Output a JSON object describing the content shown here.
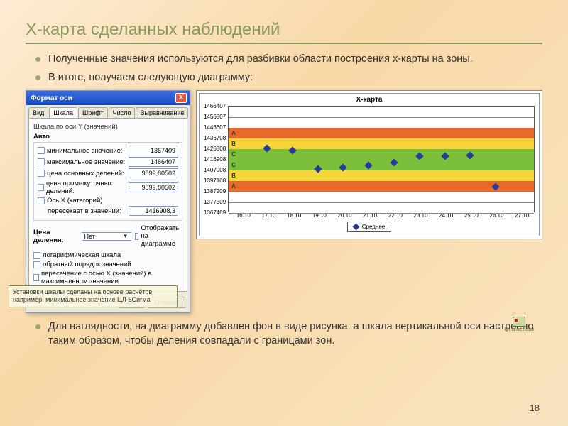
{
  "slide": {
    "title": "X-карта сделанных наблюдений",
    "bullets_top": [
      "Полученные значения используются для разбивки области построения x-карты на зоны.",
      "В итоге, получаем следующую диаграмму:"
    ],
    "bullet_bottom": "Для наглядности, на диаграмму добавлен фон в виде рисунка: а шкала вертикальной оси настроено таким образом, чтобы деления совпадали с границами зон.",
    "note": "Установки шкалы сделаны на основе расчётов, например, минимальное значение ЦЛ-5Сигма",
    "page": "18",
    "pic_caption": "От анкеВави"
  },
  "dialog": {
    "title": "Формат оси",
    "close": "X",
    "tabs": [
      "Вид",
      "Шкала",
      "Шрифт",
      "Число",
      "Выравнивание"
    ],
    "active_tab": 1,
    "section1_title": "Шкала по оси Y (значений)",
    "auto_label": "Авто",
    "fields": [
      {
        "label": "минимальное значение:",
        "value": "1367409"
      },
      {
        "label": "максимальное значение:",
        "value": "1466407"
      },
      {
        "label": "цена основных делений:",
        "value": "9899,80502"
      },
      {
        "label": "цена промежуточных делений:",
        "value": "9899,80502"
      }
    ],
    "axis_x": {
      "label": "Ось X (категорий)",
      "sublabel": "пересекает в значении:",
      "value": "1416908,3"
    },
    "unit_label": "Цена деления:",
    "unit_value": "Нет",
    "display_cb": "Отображать на диаграмме",
    "checks": [
      "логарифмическая шкала",
      "обратный порядок значений",
      "пересечение с осью X (значений) в максимальном значении"
    ],
    "ok": "ОК",
    "cancel": "Отмена"
  },
  "chart_data": {
    "type": "scatter",
    "title": "X-карта",
    "ylim": [
      1367409,
      1466407
    ],
    "y_ticks": [
      1466407,
      1456507,
      1446607,
      1436708,
      1426808,
      1416908,
      1407008,
      1397108,
      1387209,
      1377309,
      1367409
    ],
    "x_categories": [
      "16.10",
      "17.10",
      "18.10",
      "19.10",
      "20.10",
      "21.10",
      "22.10",
      "23.10",
      "24.10",
      "25.10",
      "26.10",
      "27.10"
    ],
    "bands": [
      {
        "label": "A",
        "from": 1446607,
        "to": 1436708,
        "color": "#e86a2a"
      },
      {
        "label": "B",
        "from": 1436708,
        "to": 1426808,
        "color": "#f5d63a"
      },
      {
        "label": "C",
        "from": 1426808,
        "to": 1416908,
        "color": "#7bbf3a"
      },
      {
        "label": "C",
        "from": 1416908,
        "to": 1407008,
        "color": "#7bbf3a"
      },
      {
        "label": "B",
        "from": 1407008,
        "to": 1397108,
        "color": "#f5d63a"
      },
      {
        "label": "A",
        "from": 1397108,
        "to": 1387209,
        "color": "#e86a2a"
      }
    ],
    "series": [
      {
        "name": "Среднее",
        "values": [
          {
            "x": "17.10",
            "y": 1427500
          },
          {
            "x": "18.10",
            "y": 1425500
          },
          {
            "x": "19.10",
            "y": 1408500
          },
          {
            "x": "20.10",
            "y": 1410000
          },
          {
            "x": "21.10",
            "y": 1412000
          },
          {
            "x": "22.10",
            "y": 1414500
          },
          {
            "x": "23.10",
            "y": 1420000
          },
          {
            "x": "24.10",
            "y": 1420500
          },
          {
            "x": "25.10",
            "y": 1421000
          },
          {
            "x": "26.10",
            "y": 1392000
          }
        ]
      }
    ],
    "legend_label": "Среднее"
  }
}
